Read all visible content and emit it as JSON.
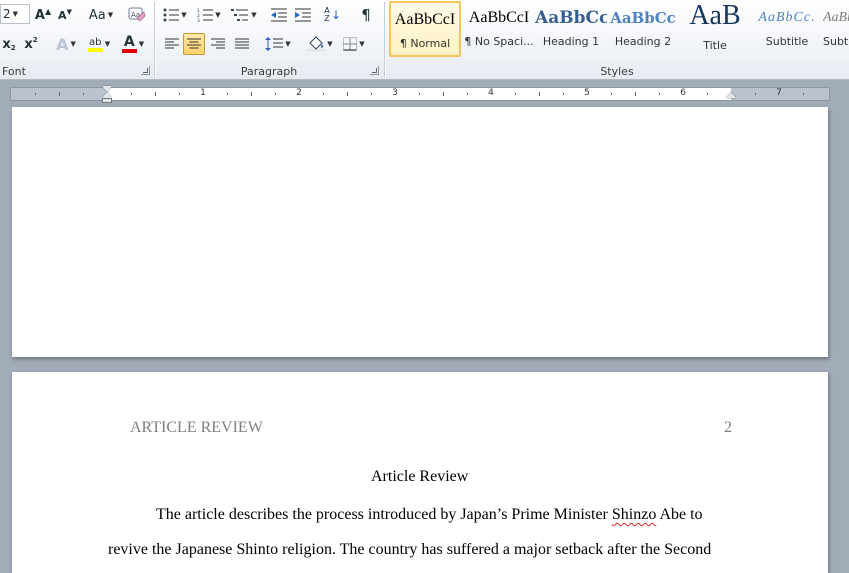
{
  "ribbon": {
    "font_group": {
      "label": "Font",
      "font_size_value": "2",
      "grow_font": "A",
      "shrink_font": "A",
      "change_case": "Aa",
      "subscript": "x",
      "superscript": "x",
      "text_effects": "A",
      "highlight_letters": "ab",
      "font_color_letter": "A"
    },
    "paragraph_group": {
      "label": "Paragraph",
      "pilcrow": "¶",
      "sort_letters": "A Z"
    },
    "styles_group": {
      "label": "Styles",
      "styles": [
        {
          "sample": "AaBbCcI",
          "name": "¶ Normal"
        },
        {
          "sample": "AaBbCcI",
          "name": "¶ No Spaci..."
        },
        {
          "sample": "AaBbCc",
          "name": "Heading 1"
        },
        {
          "sample": "AaBbCc",
          "name": "Heading 2"
        },
        {
          "sample": "AaB",
          "name": "Title"
        },
        {
          "sample": "AaBbCc.",
          "name": "Subtitle"
        },
        {
          "sample": "AaBbCcI",
          "name": "Subtle Em..."
        }
      ]
    }
  },
  "ruler": {
    "numbers": [
      "1",
      "2",
      "3",
      "4",
      "5",
      "6",
      "7"
    ]
  },
  "document": {
    "page2": {
      "header_left": "ARTICLE REVIEW",
      "page_number": "2",
      "title": "Article Review",
      "line1_before": "The article describes the process introduced by Japan’s Prime  Minister ",
      "line1_misspelled": "Shinzo",
      "line1_after": " Abe to",
      "line2": "revive the Japanese Shinto religion.  The country has suffered a major setback after the Second"
    }
  },
  "colors": {
    "workspace": "#a2acb9",
    "highlight_yellow": "#ffff00",
    "font_color_red": "#e00000",
    "active_button": "#ffd26a",
    "heading_blue": "#365f91",
    "title_blue": "#17365d",
    "subtitle_blue": "#4f81bd"
  }
}
